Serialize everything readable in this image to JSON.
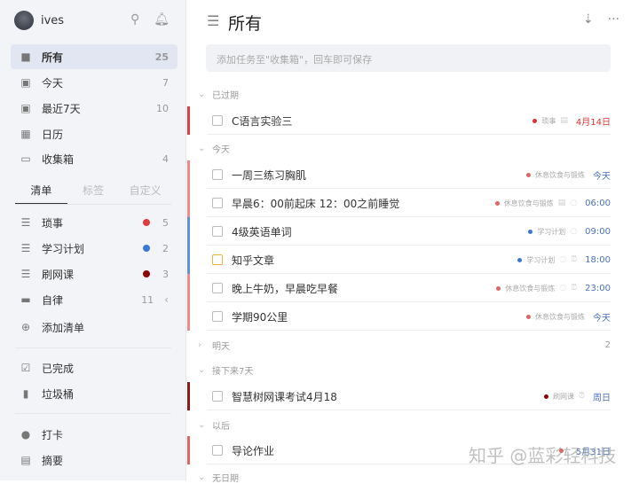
{
  "sidebar": {
    "user": "ives",
    "nav": [
      {
        "label": "所有",
        "count": "25",
        "icon": "inbox-icon"
      },
      {
        "label": "今天",
        "count": "7",
        "icon": "calendar-today-icon"
      },
      {
        "label": "最近7天",
        "count": "10",
        "icon": "calendar-week-icon"
      },
      {
        "label": "日历",
        "count": "",
        "icon": "calendar-icon"
      },
      {
        "label": "收集箱",
        "count": "4",
        "icon": "tray-icon"
      }
    ],
    "tabs": [
      "清单",
      "标签",
      "自定义"
    ],
    "lists": [
      {
        "label": "琐事",
        "count": "5",
        "color": "#e03b3b"
      },
      {
        "label": "学习计划",
        "count": "2",
        "color": "#3a78d8"
      },
      {
        "label": "刷网课",
        "count": "3",
        "color": "#8b0000"
      }
    ],
    "folder": {
      "label": "自律",
      "count": "11"
    },
    "add_list": "添加清单",
    "completed": "已完成",
    "trash": "垃圾桶",
    "checkin": "打卡",
    "summary": "摘要"
  },
  "main": {
    "title": "所有",
    "add_placeholder": "添加任务至\"收集箱\"，回车即可保存",
    "sections": {
      "overdue": "已过期",
      "today": "今天",
      "tomorrow": "明天",
      "tomorrow_count": "2",
      "next7": "接下来7天",
      "later": "以后",
      "nodate": "无日期"
    },
    "tasks": [
      {
        "title": "C语言实验三",
        "list": "琐事",
        "date": "4月14日",
        "dot": "#d33",
        "bar": "#d94343",
        "datecolor": "#d33"
      },
      {
        "title": "一周三练习胸肌",
        "list": "休息饮食与锻炼",
        "date": "今天",
        "dot": "#e06666",
        "bar": "#ef8a8a"
      },
      {
        "title": "早晨6：00前起床  12：00之前睡觉",
        "list": "休息饮食与锻炼",
        "date": "06:00",
        "dot": "#e06666",
        "bar": "#ef8a8a"
      },
      {
        "title": "4级英语单词",
        "list": "学习计划",
        "date": "09:00",
        "dot": "#3a78d8",
        "bar": "#5b8fe0"
      },
      {
        "title": "知乎文章",
        "list": "学习计划",
        "date": "18:00",
        "dot": "#3a78d8",
        "bar": "#5b8fe0"
      },
      {
        "title": "晚上牛奶，早晨吃早餐",
        "list": "休息饮食与锻炼",
        "date": "23:00",
        "dot": "#e06666",
        "bar": "#ef8a8a"
      },
      {
        "title": "学期90公里",
        "list": "休息饮食与锻炼",
        "date": "今天",
        "dot": "#e06666",
        "bar": "#ef8a8a"
      },
      {
        "title": "智慧树网课考试4月18",
        "list": "刷网课",
        "date": "周日",
        "dot": "#8b0000",
        "bar": "#8b1a1a"
      },
      {
        "title": "导论作业",
        "list": "",
        "date": "5月31日",
        "dot": "#e06666",
        "bar": "#e06666"
      }
    ]
  },
  "watermark": "知乎 @蓝彩轻科技"
}
